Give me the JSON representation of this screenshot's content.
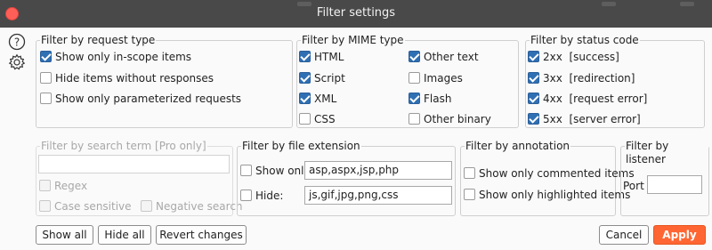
{
  "window": {
    "title": "Filter settings"
  },
  "request_type": {
    "title": "Filter by request type",
    "items": [
      {
        "label": "Show only in-scope items",
        "checked": true
      },
      {
        "label": "Hide items without responses",
        "checked": false
      },
      {
        "label": "Show only parameterized requests",
        "checked": false
      }
    ]
  },
  "mime": {
    "title": "Filter by MIME type",
    "items": [
      {
        "label": "HTML",
        "checked": true
      },
      {
        "label": "Script",
        "checked": true
      },
      {
        "label": "XML",
        "checked": true
      },
      {
        "label": "CSS",
        "checked": false
      },
      {
        "label": "Other text",
        "checked": true
      },
      {
        "label": "Images",
        "checked": false
      },
      {
        "label": "Flash",
        "checked": true
      },
      {
        "label": "Other binary",
        "checked": false
      }
    ]
  },
  "status": {
    "title": "Filter by status code",
    "items": [
      {
        "label": "2xx  [success]",
        "checked": true
      },
      {
        "label": "3xx  [redirection]",
        "checked": true
      },
      {
        "label": "4xx  [request error]",
        "checked": true
      },
      {
        "label": "5xx  [server error]",
        "checked": true
      }
    ]
  },
  "search": {
    "title": "Filter by search term [Pro only]",
    "value": "",
    "regex": "Regex",
    "case_sensitive": "Case sensitive",
    "negative": "Negative search"
  },
  "extension": {
    "title": "Filter by file extension",
    "show_only_label": "Show only:",
    "show_only_value": "asp,aspx,jsp,php",
    "hide_label": "Hide:",
    "hide_value": "js,gif,jpg,png,css"
  },
  "annotation": {
    "title": "Filter by annotation",
    "commented": "Show only commented items",
    "highlighted": "Show only highlighted items"
  },
  "listener": {
    "title": "Filter by listener",
    "port_label": "Port",
    "port_value": ""
  },
  "buttons": {
    "show_all": "Show all",
    "hide_all": "Hide all",
    "revert": "Revert changes",
    "cancel": "Cancel",
    "apply": "Apply"
  },
  "colors": {
    "accent": "#ff6633",
    "checkbox": "#2f6fb3",
    "titlebar": "#494949"
  }
}
